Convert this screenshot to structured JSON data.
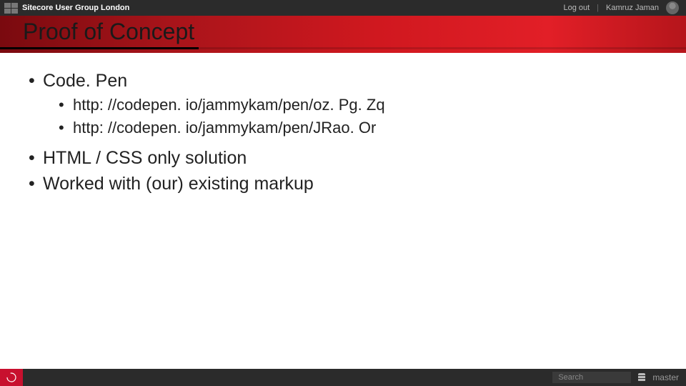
{
  "topbar": {
    "title": "Sitecore User Group London",
    "logout": "Log out",
    "user": "Kamruz Jaman"
  },
  "titleband": {
    "title": "Proof of Concept"
  },
  "body": {
    "item1": "Code. Pen",
    "sub1": "http: //codepen. io/jammykam/pen/oz. Pg. Zq",
    "sub2": "http: //codepen. io/jammykam/pen/JRao. Or",
    "item2": "HTML / CSS only solution",
    "item3": "Worked with (our) existing markup"
  },
  "bottombar": {
    "search_placeholder": "Search",
    "database": "master"
  }
}
